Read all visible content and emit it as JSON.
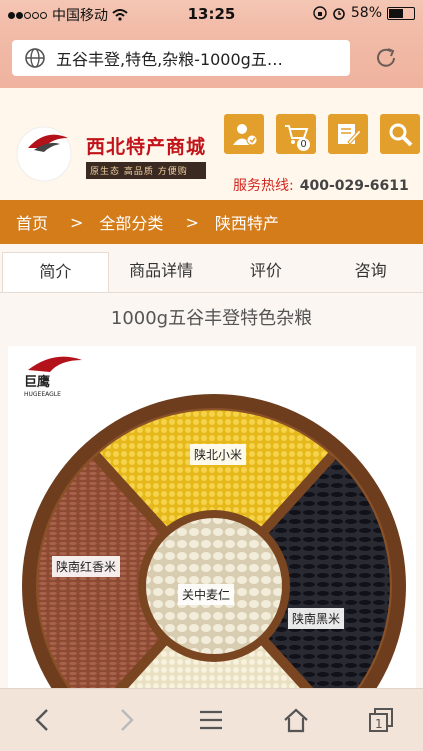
{
  "status": {
    "carrier": "中国移动",
    "time": "13:25",
    "battery": "58%"
  },
  "browser": {
    "url_title": "五谷丰登,特色,杂粮-1000g五…"
  },
  "header": {
    "logo_text": "巨鹰",
    "logo_sub": "HUGEEAGLE",
    "brand_name": "西北特产商城",
    "slogan": "原生态 高品质 方便购",
    "hotline_label": "服务热线:",
    "hotline_number": "400-029-6611",
    "cart_count": "0"
  },
  "breadcrumb": {
    "home": "首页",
    "sep": ">",
    "category": "全部分类",
    "current": "陕西特产"
  },
  "tabs": [
    {
      "label": "简介"
    },
    {
      "label": "商品详情"
    },
    {
      "label": "评价"
    },
    {
      "label": "咨询"
    }
  ],
  "product": {
    "title": "1000g五谷丰登特色杂粮",
    "image_labels": {
      "top": "陕北小米",
      "left": "陕南红香米",
      "center": "关中麦仁",
      "right": "陕南黑米"
    }
  },
  "colors": {
    "accent": "#d47b1a",
    "hotline": "#d2281f",
    "icon_bg": "#e39f2b"
  }
}
